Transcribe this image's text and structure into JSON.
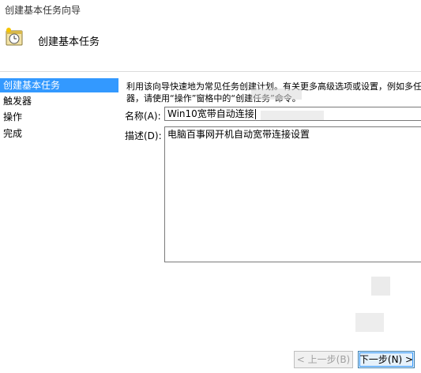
{
  "window": {
    "title": "创建基本任务向导"
  },
  "header": {
    "title": "创建基本任务",
    "icon": "clock-task-icon"
  },
  "sidebar": {
    "items": [
      {
        "label": "创建基本任务",
        "selected": true
      },
      {
        "label": "触发器",
        "selected": false
      },
      {
        "label": "操作",
        "selected": false
      },
      {
        "label": "完成",
        "selected": false
      }
    ]
  },
  "content": {
    "description_lines": [
      "利用该向导快速地为常见任务创建计划。有关更多高级选项或设置，例如多任务操",
      "器，请使用“操作”窗格中的“创建任务”命令。"
    ],
    "name_label": "名称(A):",
    "name_value": "Win10宽带自动连接",
    "desc_label": "描述(D):",
    "desc_value": "电脑百事网开机自动宽带连接设置"
  },
  "buttons": {
    "back_label": "< 上一步(B)",
    "next_label": "下一步(N) >"
  },
  "colors": {
    "selection": "#3399ff",
    "next_button_border": "#3c7fb1"
  }
}
